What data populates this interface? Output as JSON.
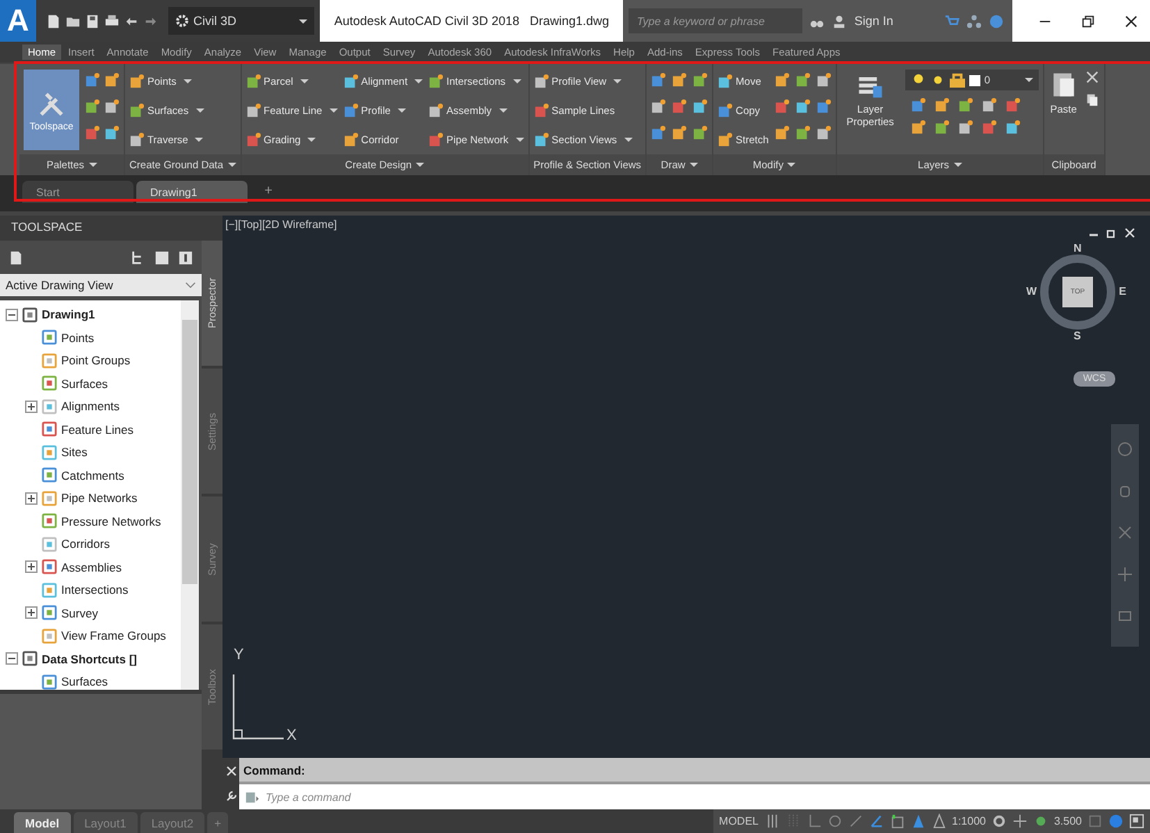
{
  "app_button": {
    "label": "A"
  },
  "workspace": {
    "value": "Civil 3D"
  },
  "window": {
    "title": "Autodesk AutoCAD Civil 3D 2018",
    "file": "Drawing1.dwg"
  },
  "search": {
    "placeholder": "Type a keyword or phrase"
  },
  "account": {
    "label": "Sign In"
  },
  "ribbon_tabs": [
    {
      "label": "Home",
      "selected": true
    },
    {
      "label": "Insert",
      "selected": false
    },
    {
      "label": "Annotate",
      "selected": false
    },
    {
      "label": "Modify",
      "selected": false
    },
    {
      "label": "Analyze",
      "selected": false
    },
    {
      "label": "View",
      "selected": false
    },
    {
      "label": "Manage",
      "selected": false
    },
    {
      "label": "Output",
      "selected": false
    },
    {
      "label": "Survey",
      "selected": false
    },
    {
      "label": "Autodesk 360",
      "selected": false
    },
    {
      "label": "Autodesk InfraWorks",
      "selected": false
    },
    {
      "label": "Help",
      "selected": false
    },
    {
      "label": "Add-ins",
      "selected": false
    },
    {
      "label": "Express Tools",
      "selected": false
    },
    {
      "label": "Featured Apps",
      "selected": false
    }
  ],
  "ribbon_panels": [
    {
      "kind": "palettes",
      "title": "Palettes",
      "menu": true,
      "large": {
        "label": "Toolspace"
      }
    },
    {
      "kind": "tools",
      "title": "Create Ground Data",
      "menu": true,
      "columns": [
        [
          {
            "label": "Points",
            "dropdown": true
          },
          {
            "label": "Surfaces",
            "dropdown": true
          },
          {
            "label": "Traverse",
            "dropdown": true
          }
        ]
      ]
    },
    {
      "kind": "tools",
      "title": "Create Design",
      "menu": true,
      "columns": [
        [
          {
            "label": "Parcel",
            "dropdown": true
          },
          {
            "label": "Feature Line",
            "dropdown": true
          },
          {
            "label": "Grading",
            "dropdown": true
          }
        ],
        [
          {
            "label": "Alignment",
            "dropdown": true
          },
          {
            "label": "Profile",
            "dropdown": true
          },
          {
            "label": "Corridor",
            "dropdown": false
          }
        ],
        [
          {
            "label": "Intersections",
            "dropdown": true
          },
          {
            "label": "Assembly",
            "dropdown": true
          },
          {
            "label": "Pipe Network",
            "dropdown": true
          }
        ]
      ]
    },
    {
      "kind": "tools",
      "title": "Profile & Section Views",
      "menu": false,
      "columns": [
        [
          {
            "label": "Profile View",
            "dropdown": true
          },
          {
            "label": "Sample Lines",
            "dropdown": false
          },
          {
            "label": "Section Views",
            "dropdown": true
          }
        ]
      ]
    },
    {
      "kind": "draw",
      "title": "Draw",
      "menu": true
    },
    {
      "kind": "modify",
      "title": "Modify",
      "menu": true,
      "columns": [
        [
          {
            "label": "Move",
            "dropdown": false
          },
          {
            "label": "Copy",
            "dropdown": false
          },
          {
            "label": "Stretch",
            "dropdown": false
          }
        ]
      ]
    },
    {
      "kind": "layers",
      "title": "Layers",
      "menu": true,
      "large": {
        "label": "Layer Properties"
      },
      "layer": "0"
    },
    {
      "kind": "clipboard",
      "title": "Clipboard",
      "menu": false,
      "large": {
        "label": "Paste"
      }
    }
  ],
  "document_tabs": [
    {
      "label": "Start",
      "selected": false
    },
    {
      "label": "Drawing1",
      "selected": true
    }
  ],
  "new_tab": {
    "label": "+"
  },
  "toolspace": {
    "title": "TOOLSPACE",
    "view": "Active Drawing View",
    "tree": [
      {
        "label": "Drawing1",
        "expanded": true,
        "children": [
          {
            "label": "Points"
          },
          {
            "label": "Point Groups"
          },
          {
            "label": "Surfaces"
          },
          {
            "label": "Alignments",
            "expanded": false
          },
          {
            "label": "Feature Lines"
          },
          {
            "label": "Sites"
          },
          {
            "label": "Catchments"
          },
          {
            "label": "Pipe Networks",
            "expanded": false
          },
          {
            "label": "Pressure Networks"
          },
          {
            "label": "Corridors"
          },
          {
            "label": "Assemblies",
            "expanded": false
          },
          {
            "label": "Intersections"
          },
          {
            "label": "Survey",
            "expanded": false
          },
          {
            "label": "View Frame Groups"
          }
        ]
      },
      {
        "label": "Data Shortcuts []",
        "expanded": true,
        "children": [
          {
            "label": "Surfaces"
          }
        ]
      }
    ],
    "side_tabs": [
      {
        "label": "Prospector",
        "selected": true
      },
      {
        "label": "Settings",
        "selected": false
      },
      {
        "label": "Survey",
        "selected": false
      },
      {
        "label": "Toolbox",
        "selected": false
      }
    ]
  },
  "viewport": {
    "label": "[−][Top][2D Wireframe]",
    "compass": {
      "north": "N",
      "south": "S",
      "east": "E",
      "west": "W",
      "face": "TOP"
    },
    "ucs_menu": "WCS",
    "axis_y": "Y",
    "axis_x": "X"
  },
  "command_line": {
    "label": "Command:",
    "placeholder": "Type a command"
  },
  "layout_tabs": [
    {
      "label": "Model",
      "selected": true
    },
    {
      "label": "Layout1",
      "selected": false
    },
    {
      "label": "Layout2",
      "selected": false
    }
  ],
  "new_layout": {
    "label": "+"
  },
  "status_bar": {
    "mode": "MODEL",
    "scale": "1:1000",
    "value": "3.500"
  }
}
